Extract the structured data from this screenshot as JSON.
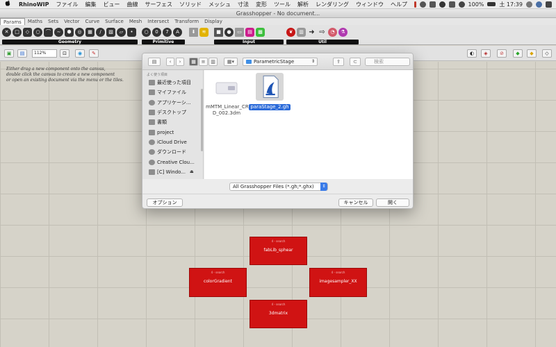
{
  "menubar": {
    "apple": "",
    "items": [
      "RhinoWIP",
      "ファイル",
      "編集",
      "ビュー",
      "曲線",
      "サーフェス",
      "ソリッド",
      "メッシュ",
      "寸法",
      "変形",
      "ツール",
      "解析",
      "レンダリング",
      "ウィンドウ",
      "ヘルプ"
    ],
    "battery": "100%",
    "time": "土 17:39"
  },
  "window": {
    "title": "Grasshopper - No document..."
  },
  "tabs": [
    "Params",
    "Maths",
    "Sets",
    "Vector",
    "Curve",
    "Surface",
    "Mesh",
    "Intersect",
    "Transform",
    "Display"
  ],
  "ribbon_groups": [
    "Geometry",
    "Primitive",
    "Input",
    "Util"
  ],
  "toolbar": {
    "zoom": "112%"
  },
  "canvas": {
    "hint": [
      "Either drag a new component onto the canvas,",
      "double click the canvas to create a new component",
      "or open an existing document via the menu or the tiles."
    ],
    "nodes": [
      {
        "sub": "4 - search",
        "name": "fabLib_sphear"
      },
      {
        "sub": "4 - search",
        "name": "colorGradient"
      },
      {
        "sub": "4 - search",
        "name": "imagesampler_XX"
      },
      {
        "sub": "4 - search",
        "name": "3dmatrix"
      }
    ]
  },
  "dialog": {
    "location": "ParametricStage",
    "search_placeholder": "検索",
    "sidebar_header": "よく使う項目",
    "sidebar": [
      "最近使った項目",
      "マイファイル",
      "アプリケーシ...",
      "デスクトップ",
      "書類",
      "project",
      "iCloud Drive",
      "ダウンロード",
      "Creative Clou...",
      "[C] Windo..."
    ],
    "files": [
      {
        "name": "mMTM_Linear_CRD_002.3dm",
        "line1": "mMTM_Linear_CR",
        "line2": "D_002.3dm"
      },
      {
        "name": "paraStage_2.gh",
        "selected": true
      }
    ],
    "filter": "All Grasshopper Files (*.gh;*.ghx)",
    "options": "オプション",
    "cancel": "キャンセル",
    "open": "開く"
  }
}
